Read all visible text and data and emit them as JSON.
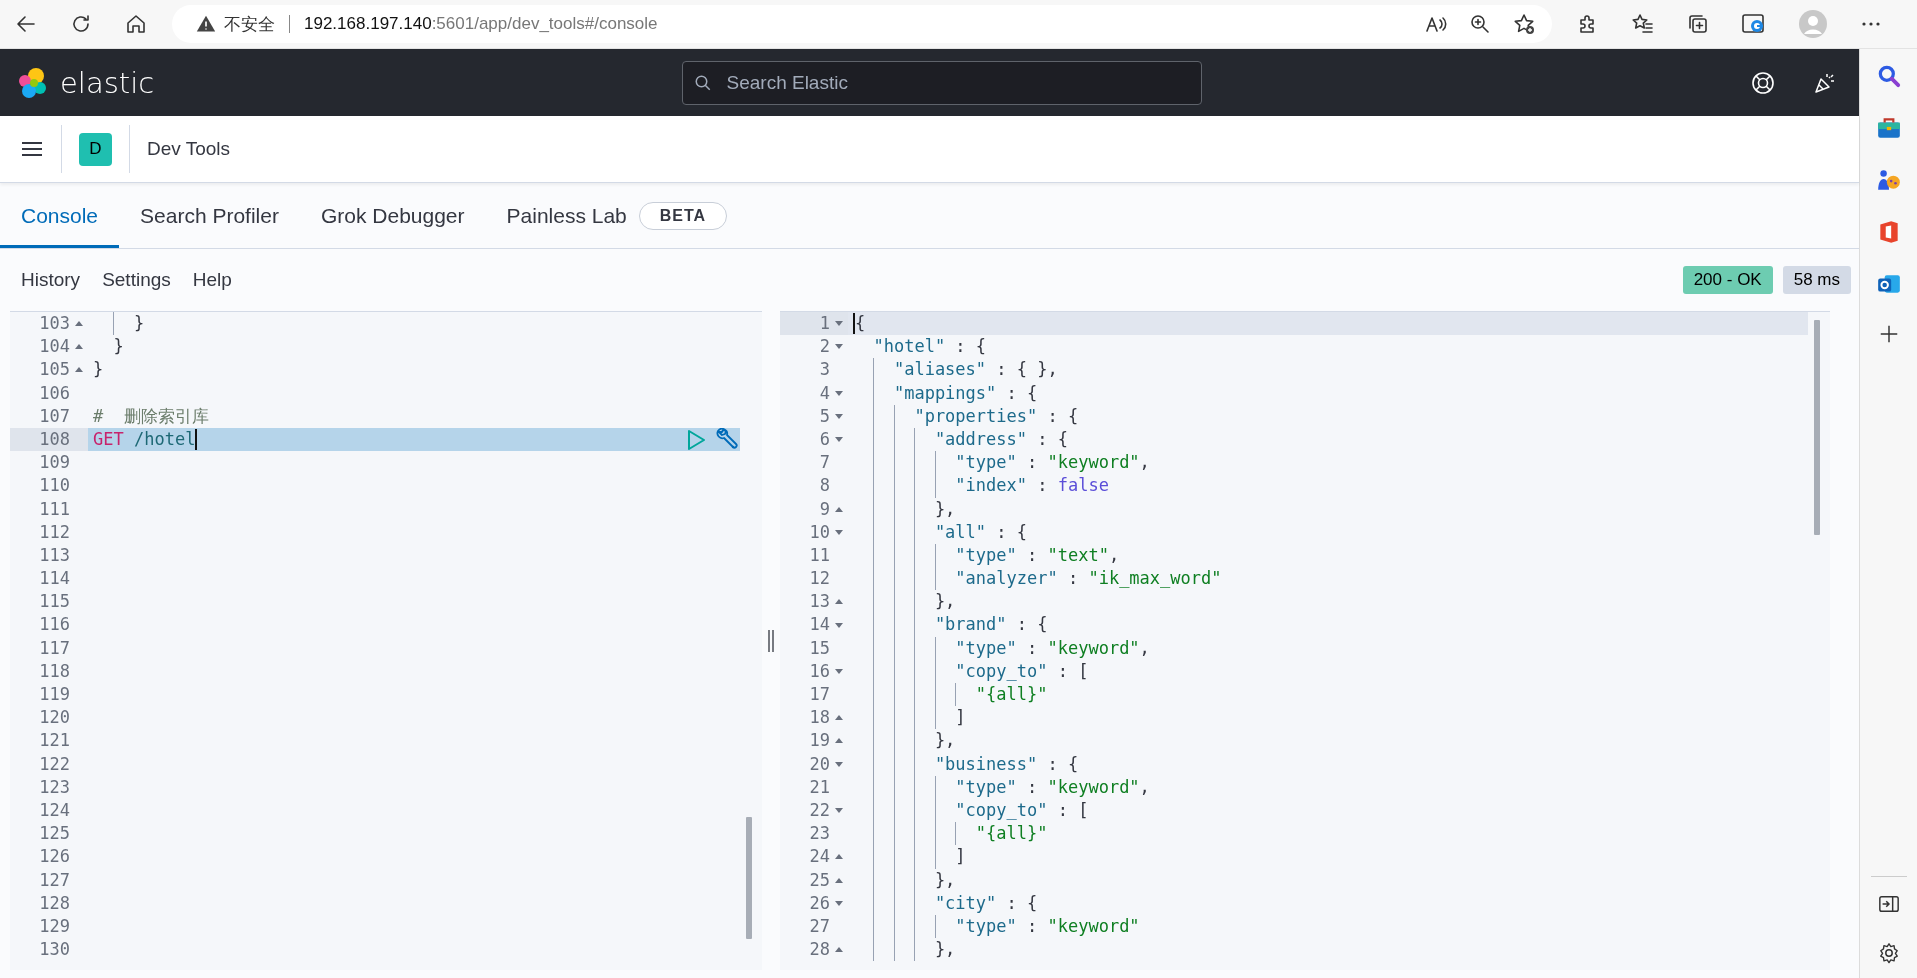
{
  "browser": {
    "security_label": "不安全",
    "url_host": "192.168.197.140",
    "url_path": ":5601/app/dev_tools#/console"
  },
  "header": {
    "logo_text": "elastic",
    "search": {
      "placeholder": "Search Elastic"
    }
  },
  "breadcrumbs": {
    "avatar": "D",
    "title": "Dev Tools"
  },
  "tabs": [
    {
      "label": "Console",
      "selected": true
    },
    {
      "label": "Search Profiler",
      "selected": false
    },
    {
      "label": "Grok Debugger",
      "selected": false
    },
    {
      "label": "Painless Lab",
      "selected": false,
      "badge": "BETA"
    }
  ],
  "toolbar": {
    "items": [
      "History",
      "Settings",
      "Help"
    ],
    "status": "200 - OK",
    "time": "58 ms"
  },
  "request_editor": {
    "kind": "request",
    "lines": [
      {
        "number": "103",
        "kind": "closer",
        "active": false,
        "code": [
          {
            "kind": "punct",
            "text": "    }"
          }
        ]
      },
      {
        "number": "104",
        "kind": "closer",
        "active": false,
        "code": [
          {
            "kind": "punct",
            "text": "  }"
          }
        ]
      },
      {
        "number": "105",
        "kind": "closer",
        "active": false,
        "code": [
          {
            "kind": "punct",
            "text": "}"
          }
        ]
      },
      {
        "number": "106",
        "kind": "plain",
        "active": false
      },
      {
        "number": "107",
        "kind": "plain",
        "active": false,
        "code": [
          {
            "kind": "comment",
            "text": "#  删除索引库"
          }
        ]
      },
      {
        "number": "108",
        "kind": "plain",
        "active": true,
        "code": [
          {
            "kind": "method",
            "text": "GET"
          },
          {
            "kind": "path",
            "text": " /hotel"
          }
        ]
      },
      {
        "number": "109",
        "kind": "plain",
        "active": false
      },
      {
        "number": "110",
        "kind": "plain",
        "active": false
      },
      {
        "number": "111",
        "kind": "plain",
        "active": false
      },
      {
        "number": "112",
        "kind": "plain",
        "active": false
      },
      {
        "number": "113",
        "kind": "plain",
        "active": false
      },
      {
        "number": "114",
        "kind": "plain",
        "active": false
      },
      {
        "number": "115",
        "kind": "plain",
        "active": false
      },
      {
        "number": "116",
        "kind": "plain",
        "active": false
      },
      {
        "number": "117",
        "kind": "plain",
        "active": false
      },
      {
        "number": "118",
        "kind": "plain",
        "active": false
      },
      {
        "number": "119",
        "kind": "plain",
        "active": false
      },
      {
        "number": "120",
        "kind": "plain",
        "active": false
      },
      {
        "number": "121",
        "kind": "plain",
        "active": false
      },
      {
        "number": "122",
        "kind": "plain",
        "active": false
      },
      {
        "number": "123",
        "kind": "plain",
        "active": false
      },
      {
        "number": "124",
        "kind": "plain",
        "active": false
      },
      {
        "number": "125",
        "kind": "plain",
        "active": false
      },
      {
        "number": "126",
        "kind": "plain",
        "active": false
      },
      {
        "number": "127",
        "kind": "plain",
        "active": false
      },
      {
        "number": "128",
        "kind": "plain",
        "active": false
      },
      {
        "number": "129",
        "kind": "plain",
        "active": false
      },
      {
        "number": "130",
        "kind": "plain",
        "active": false
      }
    ]
  },
  "response_editor": {
    "kind": "response",
    "lines": [
      {
        "number": "1",
        "kind": "opener",
        "active": true,
        "code": [
          {
            "kind": "punct",
            "text": "{"
          }
        ]
      },
      {
        "number": "2",
        "kind": "opener",
        "active": false,
        "code": [
          {
            "kind": "key",
            "text": "  \"hotel\""
          },
          {
            "kind": "punct",
            "text": " : {"
          }
        ]
      },
      {
        "number": "3",
        "kind": "plain",
        "active": false,
        "code": [
          {
            "kind": "key",
            "text": "    \"aliases\""
          },
          {
            "kind": "punct",
            "text": " : { },"
          }
        ]
      },
      {
        "number": "4",
        "kind": "opener",
        "active": false,
        "code": [
          {
            "kind": "key",
            "text": "    \"mappings\""
          },
          {
            "kind": "punct",
            "text": " : {"
          }
        ]
      },
      {
        "number": "5",
        "kind": "opener",
        "active": false,
        "code": [
          {
            "kind": "key",
            "text": "      \"properties\""
          },
          {
            "kind": "punct",
            "text": " : {"
          }
        ]
      },
      {
        "number": "6",
        "kind": "opener",
        "active": false,
        "code": [
          {
            "kind": "key",
            "text": "        \"address\""
          },
          {
            "kind": "punct",
            "text": " : {"
          }
        ]
      },
      {
        "number": "7",
        "kind": "plain",
        "active": false,
        "code": [
          {
            "kind": "key",
            "text": "          \"type\""
          },
          {
            "kind": "punct",
            "text": " : "
          },
          {
            "kind": "str",
            "text": "\"keyword\""
          },
          {
            "kind": "punct",
            "text": ","
          }
        ]
      },
      {
        "number": "8",
        "kind": "plain",
        "active": false,
        "code": [
          {
            "kind": "key",
            "text": "          \"index\""
          },
          {
            "kind": "punct",
            "text": " : "
          },
          {
            "kind": "bool",
            "text": "false"
          }
        ]
      },
      {
        "number": "9",
        "kind": "closer",
        "active": false,
        "code": [
          {
            "kind": "punct",
            "text": "        },"
          }
        ]
      },
      {
        "number": "10",
        "kind": "opener",
        "active": false,
        "code": [
          {
            "kind": "key",
            "text": "        \"all\""
          },
          {
            "kind": "punct",
            "text": " : {"
          }
        ]
      },
      {
        "number": "11",
        "kind": "plain",
        "active": false,
        "code": [
          {
            "kind": "key",
            "text": "          \"type\""
          },
          {
            "kind": "punct",
            "text": " : "
          },
          {
            "kind": "str",
            "text": "\"text\""
          },
          {
            "kind": "punct",
            "text": ","
          }
        ]
      },
      {
        "number": "12",
        "kind": "plain",
        "active": false,
        "code": [
          {
            "kind": "key",
            "text": "          \"analyzer\""
          },
          {
            "kind": "punct",
            "text": " : "
          },
          {
            "kind": "str",
            "text": "\"ik_max_word\""
          }
        ]
      },
      {
        "number": "13",
        "kind": "closer",
        "active": false,
        "code": [
          {
            "kind": "punct",
            "text": "        },"
          }
        ]
      },
      {
        "number": "14",
        "kind": "opener",
        "active": false,
        "code": [
          {
            "kind": "key",
            "text": "        \"brand\""
          },
          {
            "kind": "punct",
            "text": " : {"
          }
        ]
      },
      {
        "number": "15",
        "kind": "plain",
        "active": false,
        "code": [
          {
            "kind": "key",
            "text": "          \"type\""
          },
          {
            "kind": "punct",
            "text": " : "
          },
          {
            "kind": "str",
            "text": "\"keyword\""
          },
          {
            "kind": "punct",
            "text": ","
          }
        ]
      },
      {
        "number": "16",
        "kind": "opener",
        "active": false,
        "code": [
          {
            "kind": "key",
            "text": "          \"copy_to\""
          },
          {
            "kind": "punct",
            "text": " : ["
          }
        ]
      },
      {
        "number": "17",
        "kind": "plain",
        "active": false,
        "code": [
          {
            "kind": "str",
            "text": "            \"{all}\""
          }
        ]
      },
      {
        "number": "18",
        "kind": "closer",
        "active": false,
        "code": [
          {
            "kind": "punct",
            "text": "          ]"
          }
        ]
      },
      {
        "number": "19",
        "kind": "closer",
        "active": false,
        "code": [
          {
            "kind": "punct",
            "text": "        },"
          }
        ]
      },
      {
        "number": "20",
        "kind": "opener",
        "active": false,
        "code": [
          {
            "kind": "key",
            "text": "        \"business\""
          },
          {
            "kind": "punct",
            "text": " : {"
          }
        ]
      },
      {
        "number": "21",
        "kind": "plain",
        "active": false,
        "code": [
          {
            "kind": "key",
            "text": "          \"type\""
          },
          {
            "kind": "punct",
            "text": " : "
          },
          {
            "kind": "str",
            "text": "\"keyword\""
          },
          {
            "kind": "punct",
            "text": ","
          }
        ]
      },
      {
        "number": "22",
        "kind": "opener",
        "active": false,
        "code": [
          {
            "kind": "key",
            "text": "          \"copy_to\""
          },
          {
            "kind": "punct",
            "text": " : ["
          }
        ]
      },
      {
        "number": "23",
        "kind": "plain",
        "active": false,
        "code": [
          {
            "kind": "str",
            "text": "            \"{all}\""
          }
        ]
      },
      {
        "number": "24",
        "kind": "closer",
        "active": false,
        "code": [
          {
            "kind": "punct",
            "text": "          ]"
          }
        ]
      },
      {
        "number": "25",
        "kind": "closer",
        "active": false,
        "code": [
          {
            "kind": "punct",
            "text": "        },"
          }
        ]
      },
      {
        "number": "26",
        "kind": "opener",
        "active": false,
        "code": [
          {
            "kind": "key",
            "text": "        \"city\""
          },
          {
            "kind": "punct",
            "text": " : {"
          }
        ]
      },
      {
        "number": "27",
        "kind": "plain",
        "active": false,
        "code": [
          {
            "kind": "key",
            "text": "          \"type\""
          },
          {
            "kind": "punct",
            "text": " : "
          },
          {
            "kind": "str",
            "text": "\"keyword\""
          }
        ]
      },
      {
        "number": "28",
        "kind": "closer",
        "active": false,
        "code": [
          {
            "kind": "punct",
            "text": "        },"
          }
        ]
      }
    ]
  }
}
